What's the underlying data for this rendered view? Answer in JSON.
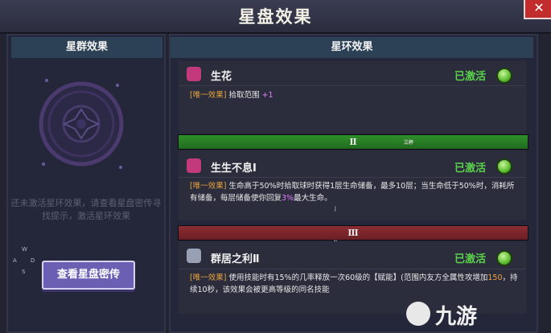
{
  "window": {
    "title": "星盘效果",
    "close_icon": "close-icon"
  },
  "left_panel": {
    "header": "星群效果",
    "hint": "还未激活星环效果，请查看星盘密传寻找提示，激活星环效果",
    "compass": {
      "w": "W",
      "d": "D",
      "a": "A",
      "s": "S"
    },
    "button": "查看星盘密传"
  },
  "right_panel": {
    "header": "星环效果",
    "entries": [
      {
        "name": "生花",
        "status": "已激活",
        "tag": "[唯一效果]",
        "desc": "拾取范围",
        "desc_value": "+1",
        "icon": "flower-icon"
      },
      {
        "name": "生生不息Ⅰ",
        "status": "已激活",
        "tag": "[唯一效果]",
        "desc_a": "生命高于50%时拾取球时获得1层生命储备，最多10层；当生命低于50%时，消耗所有储备，每层储备使你回复",
        "desc_value": "3%",
        "desc_b": "最大生命。",
        "icon": "flower-icon"
      },
      {
        "name": "群居之利Ⅱ",
        "status": "已激活",
        "tag": "[唯一效果]",
        "desc_a": "使用技能时有15%的几率释放一次60级的【赋能】(范围内友方全属性攻增加",
        "desc_value": "150",
        "desc_b": "，持续10秒，该效果会被更高等级的同名技能",
        "icon": "wolf-icon"
      }
    ],
    "tiers": [
      {
        "numeral": "Ⅱ",
        "tiny": "三杯"
      },
      {
        "numeral": "Ⅲ",
        "tiny": "N"
      }
    ],
    "stray_j": "J"
  },
  "watermark": {
    "text": "九游"
  },
  "colors": {
    "active_green": "#5ad14b",
    "tag_orange": "#e6a23c",
    "value_pink": "#e37aff",
    "button_purple": "#6b5fb4"
  }
}
